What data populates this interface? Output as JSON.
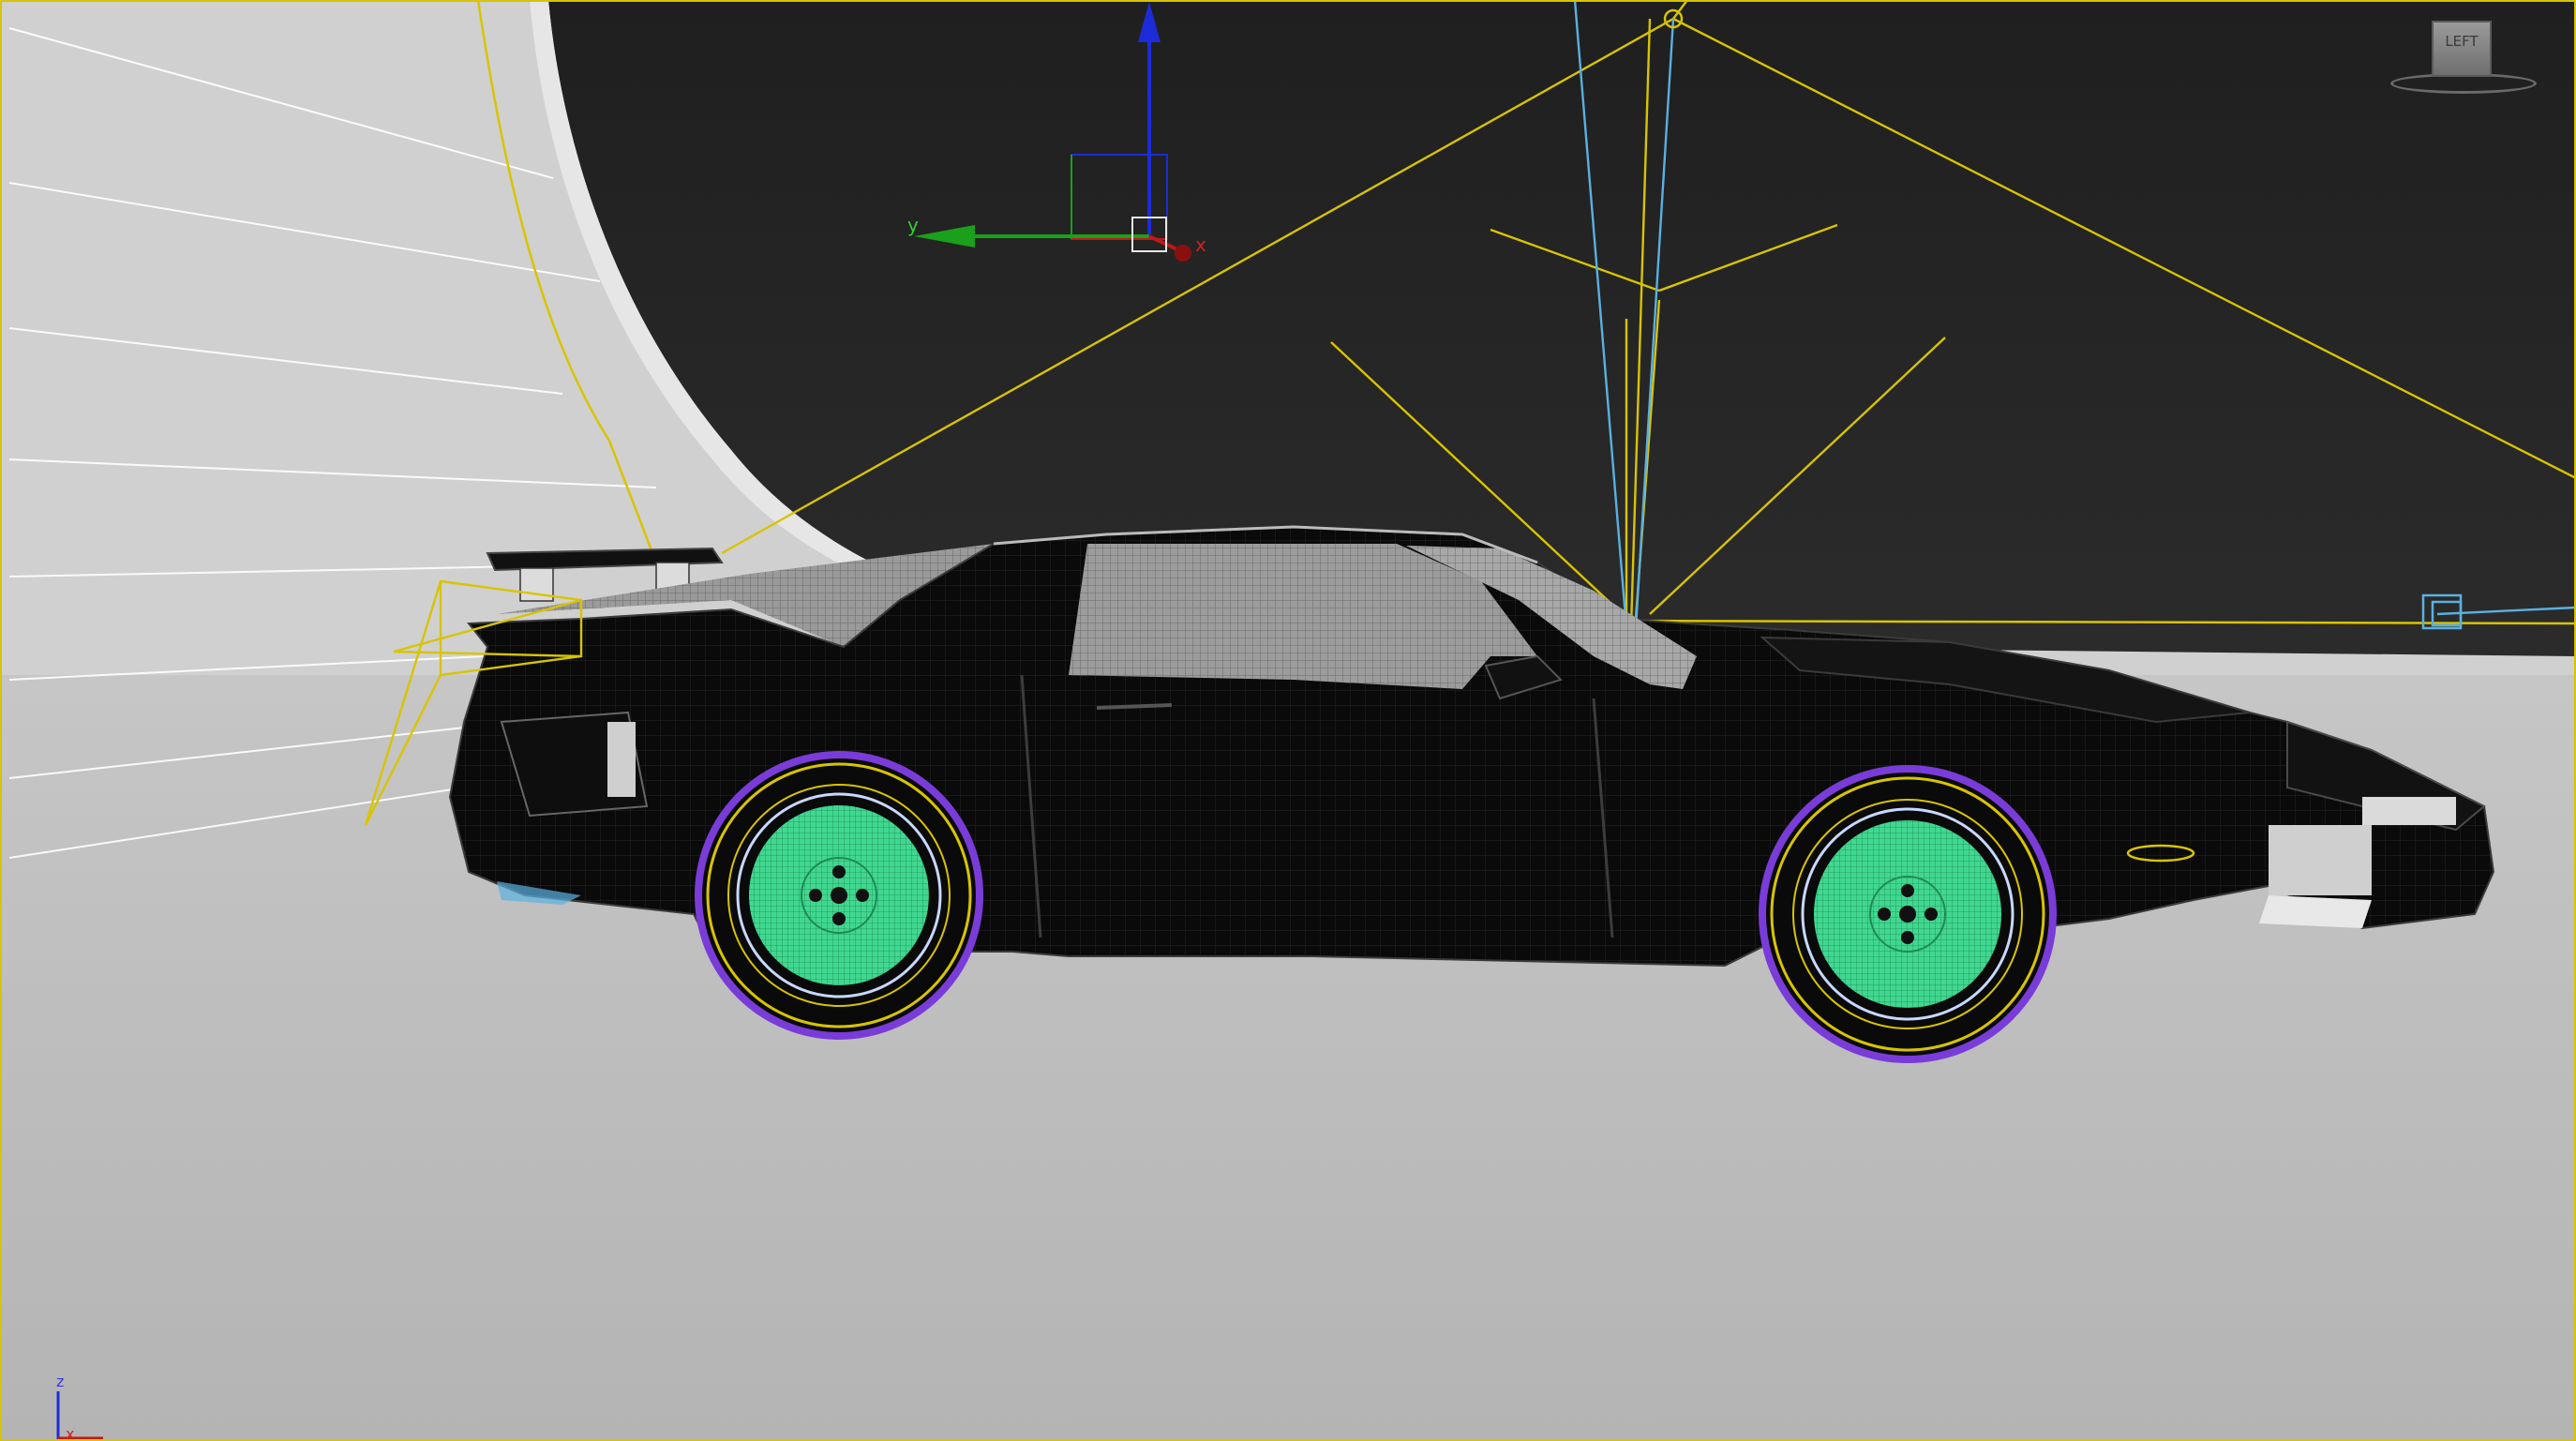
{
  "viewport": {
    "view_label": "LEFT",
    "gizmo_axes": {
      "x": "x",
      "y": "y",
      "z": "z"
    },
    "world_axes": {
      "x": "x",
      "z": "z"
    }
  },
  "colors": {
    "background_dark": "#2a2a2a",
    "ground": "#b9b9b9",
    "cyclorama": "#cfcfcf",
    "car_body": "#080808",
    "wireframe_lines": "#3c3c3c",
    "selection_yellow": "#d8c400",
    "light_blue": "#5ab0e0",
    "wheel_rim": "#3fd48e",
    "tire_purple": "#7a3cd8",
    "axis_x": "#c01818",
    "axis_y": "#1aa01a",
    "axis_z": "#1c2cd8"
  },
  "icons": [
    "viewcube-icon",
    "transform-gizmo-icon",
    "world-axis-tripod-icon"
  ]
}
